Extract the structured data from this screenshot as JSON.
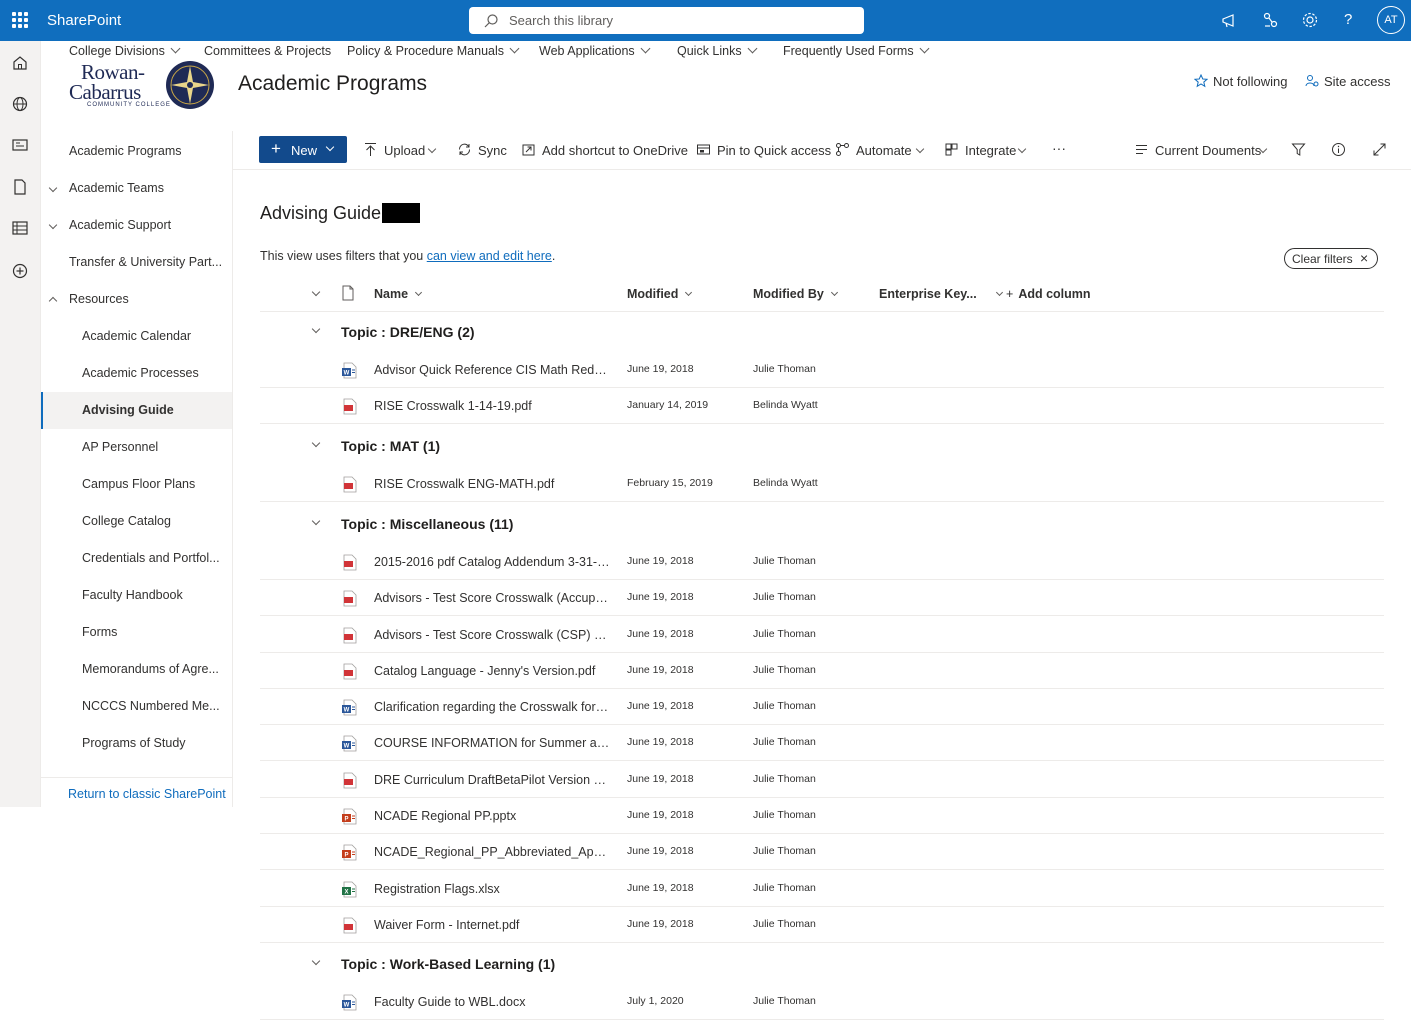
{
  "suite": {
    "app_name": "SharePoint",
    "search_placeholder": "Search this library",
    "avatar_initials": "AT"
  },
  "hub_nav": [
    {
      "label": "College Divisions",
      "has_menu": true
    },
    {
      "label": "Committees & Projects",
      "has_menu": false
    },
    {
      "label": "Policy & Procedure Manuals",
      "has_menu": true
    },
    {
      "label": "Web Applications",
      "has_menu": true
    },
    {
      "label": "Quick Links",
      "has_menu": true
    },
    {
      "label": "Frequently Used Forms",
      "has_menu": true
    }
  ],
  "site": {
    "logo_line1": "Rowan-",
    "logo_line2": "Cabarrus",
    "logo_line3": "COMMUNITY COLLEGE",
    "title": "Academic Programs",
    "follow_label": "Not following",
    "access_label": "Site access"
  },
  "left_nav": {
    "items": [
      {
        "label": "Academic Programs",
        "level": 0,
        "chevron": "none"
      },
      {
        "label": "Academic Teams",
        "level": 0,
        "chevron": "down"
      },
      {
        "label": "Academic Support",
        "level": 0,
        "chevron": "down"
      },
      {
        "label": "Transfer & University Part...",
        "level": 0,
        "chevron": "none"
      },
      {
        "label": "Resources",
        "level": 0,
        "chevron": "up"
      },
      {
        "label": "Academic Calendar",
        "level": 1,
        "chevron": "none"
      },
      {
        "label": "Academic Processes",
        "level": 1,
        "chevron": "none"
      },
      {
        "label": "Advising Guide",
        "level": 1,
        "chevron": "none",
        "selected": true
      },
      {
        "label": "AP Personnel",
        "level": 1,
        "chevron": "none"
      },
      {
        "label": "Campus Floor Plans",
        "level": 1,
        "chevron": "none"
      },
      {
        "label": "College Catalog",
        "level": 1,
        "chevron": "none"
      },
      {
        "label": "Credentials and Portfol...",
        "level": 1,
        "chevron": "none"
      },
      {
        "label": "Faculty Handbook",
        "level": 1,
        "chevron": "none"
      },
      {
        "label": "Forms",
        "level": 1,
        "chevron": "none"
      },
      {
        "label": "Memorandums of Agre...",
        "level": 1,
        "chevron": "none"
      },
      {
        "label": "NCCCS Numbered Me...",
        "level": 1,
        "chevron": "none"
      },
      {
        "label": "Programs of Study",
        "level": 1,
        "chevron": "none"
      }
    ],
    "footer_link": "Return to classic SharePoint"
  },
  "command_bar": {
    "new_label": "New",
    "upload_label": "Upload",
    "sync_label": "Sync",
    "shortcut_label": "Add shortcut to OneDrive",
    "pin_label": "Pin to Quick access",
    "automate_label": "Automate",
    "integrate_label": "Integrate",
    "more_label": "···",
    "view_label": "Current Douments"
  },
  "library": {
    "title": "Advising Guide",
    "filter_note_prefix": "This view uses filters that you ",
    "filter_note_link": "can view and edit here",
    "filter_note_suffix": ".",
    "clear_filters_label": "Clear filters"
  },
  "columns": {
    "name": "Name",
    "modified": "Modified",
    "modified_by": "Modified By",
    "enterprise_keywords": "Enterprise Key...",
    "add_column": "Add column"
  },
  "groups": [
    {
      "label": "Topic : DRE/ENG (2)",
      "rows": [
        {
          "type": "word",
          "name": "Advisor Quick Reference CIS Math Red  EN...",
          "modified": "June 19, 2018",
          "modified_by": "Julie Thoman"
        },
        {
          "type": "pdf",
          "name": "RISE Crosswalk 1-14-19.pdf",
          "modified": "January 14, 2019",
          "modified_by": "Belinda Wyatt"
        }
      ]
    },
    {
      "label": "Topic : MAT (1)",
      "rows": [
        {
          "type": "pdf",
          "name": "RISE Crosswalk ENG-MATH.pdf",
          "modified": "February 15, 2019",
          "modified_by": "Belinda Wyatt"
        }
      ]
    },
    {
      "label": "Topic : Miscellaneous (11)",
      "rows": [
        {
          "type": "pdf",
          "name": "2015-2016 pdf Catalog Addendum 3-31-20...",
          "modified": "June 19, 2018",
          "modified_by": "Julie Thoman"
        },
        {
          "type": "pdf",
          "name": "Advisors - Test Score Crosswalk (Accuplacer...",
          "modified": "June 19, 2018",
          "modified_by": "Julie Thoman"
        },
        {
          "type": "pdf",
          "name": "Advisors - Test Score Crosswalk (CSP) - Fall ...",
          "modified": "June 19, 2018",
          "modified_by": "Julie Thoman"
        },
        {
          "type": "pdf",
          "name": "Catalog Language - Jenny's Version.pdf",
          "modified": "June 19, 2018",
          "modified_by": "Julie Thoman"
        },
        {
          "type": "word",
          "name": "Clarification regarding the Crosswalk for Ac...",
          "modified": "June 19, 2018",
          "modified_by": "Julie Thoman"
        },
        {
          "type": "word",
          "name": "COURSE INFORMATION for Summer and Fa...",
          "modified": "June 19, 2018",
          "modified_by": "Julie Thoman"
        },
        {
          "type": "pdf",
          "name": "DRE Curriculum DraftBetaPilot Version Revi...",
          "modified": "June 19, 2018",
          "modified_by": "Julie Thoman"
        },
        {
          "type": "ppt",
          "name": "NCADE Regional PP.pptx",
          "modified": "June 19, 2018",
          "modified_by": "Julie Thoman"
        },
        {
          "type": "ppt",
          "name": "NCADE_Regional_PP_Abbreviated_April_20...",
          "modified": "June 19, 2018",
          "modified_by": "Julie Thoman"
        },
        {
          "type": "excel",
          "name": "Registration Flags.xlsx",
          "modified": "June 19, 2018",
          "modified_by": "Julie Thoman"
        },
        {
          "type": "pdf",
          "name": "Waiver Form - Internet.pdf",
          "modified": "June 19, 2018",
          "modified_by": "Julie Thoman"
        }
      ]
    },
    {
      "label": "Topic : Work-Based Learning (1)",
      "rows": [
        {
          "type": "word",
          "name": "Faculty Guide to WBL.docx",
          "modified": "July 1, 2020",
          "modified_by": "Julie Thoman"
        }
      ]
    }
  ],
  "colors": {
    "suite_bar": "#106ebe",
    "accent": "#0f6cbd",
    "new_button": "#124a8c",
    "word": "#2b579a",
    "pdf": "#d13438",
    "ppt": "#c43e1c",
    "excel": "#217346"
  }
}
